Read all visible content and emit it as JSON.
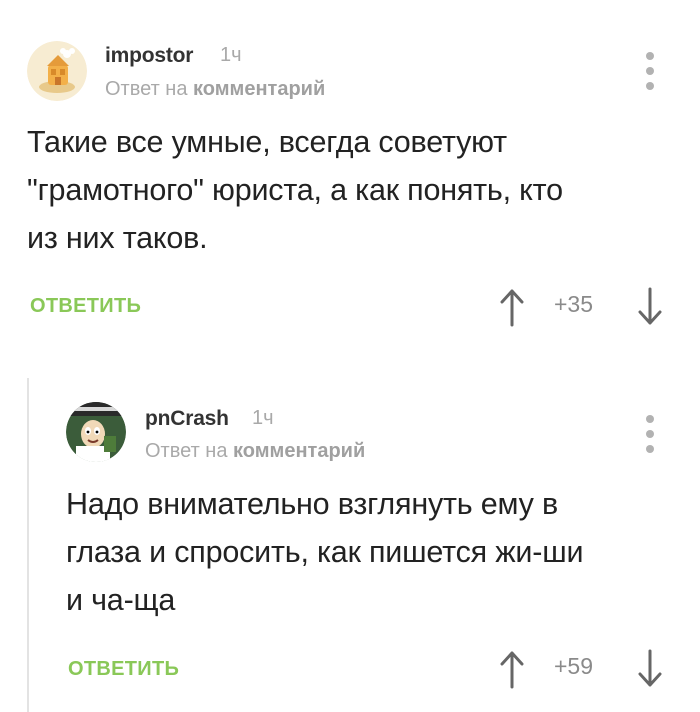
{
  "comments": [
    {
      "username": "impostor",
      "time": "1ч",
      "reply_prefix": "Ответ на",
      "reply_link": "комментарий",
      "text": "Такие все умные, всегда советуют\n\"грамотного\" юриста, а как понять, кто\nиз них таков.",
      "reply_label": "ОТВЕТИТЬ",
      "rating": "+35",
      "avatar_icon": "cat-cartoon-avatar"
    },
    {
      "username": "pnCrash",
      "time": "1ч",
      "reply_prefix": "Ответ на",
      "reply_link": "комментарий",
      "text": "Надо внимательно взглянуть ему в\nглаза и спросить, как пишется жи-ши\nи ча-ща",
      "reply_label": "ОТВЕТИТЬ",
      "rating": "+59",
      "avatar_icon": "cartoon-character-avatar"
    }
  ],
  "colors": {
    "accent_green": "#8ac858",
    "muted_gray": "#a9a9a9",
    "text_dark": "#222222"
  }
}
